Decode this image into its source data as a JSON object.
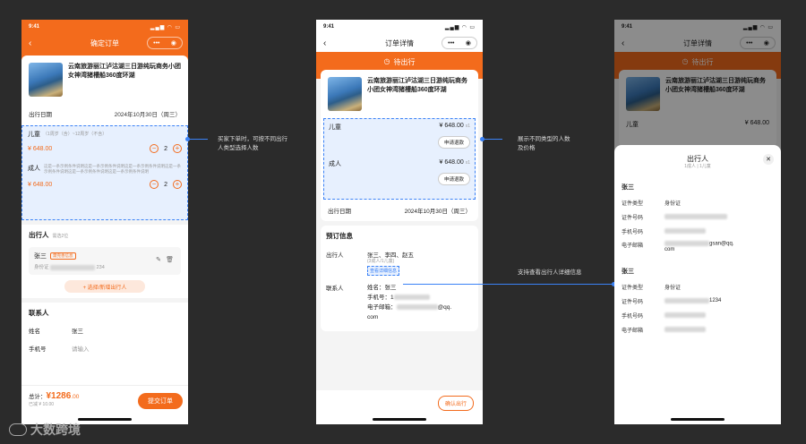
{
  "status_time": "9:41",
  "product": {
    "title": "云南旅游丽江泸沽湖三日游纯玩商务小团女神湾猪槽船360度环湖"
  },
  "phone1": {
    "nav_title": "确定订单",
    "date_label": "出行日期",
    "date_value": "2024年10月30日（周三）",
    "child_label": "儿童",
    "child_desc": "（1周岁（含）~12周岁（不含）",
    "child_price": "¥ 648.00",
    "child_qty": "2",
    "adult_label": "成人",
    "adult_desc": "这是一条示例条件说明这是一条示例条件说明这是一条示例条件说明这是一条示例条件说明这是一条示例条件说明这是一条示例条件说明",
    "adult_price": "¥ 648.00",
    "adult_qty": "2",
    "traveler_title": "出行人",
    "traveler_hint": "需选2位",
    "traveler_name": "张三",
    "traveler_tag": "需完善信息",
    "traveler_id_label": "身份证",
    "traveler_id_tail": "234",
    "add_traveler": "+ 选择/新增出行人",
    "contact_title": "联系人",
    "name_label": "姓名",
    "name_value": "张三",
    "phone_label": "手机号",
    "phone_placeholder": "请输入",
    "total_label": "总计：",
    "total_value": "¥1286",
    "total_cents": ".00",
    "discount": "已减 ¥ 10.00",
    "submit": "提交订单"
  },
  "phone2": {
    "nav_title": "订单详情",
    "status": "待出行",
    "child_label": "儿童",
    "child_price": "¥ 648.00",
    "child_qty": "x1",
    "refund": "申请退款",
    "adult_label": "成人",
    "adult_price": "¥ 648.00",
    "adult_qty": "x1",
    "date_label": "出行日期",
    "date_value": "2024年10月30日（周三）",
    "booking_title": "预订信息",
    "traveler_label": "出行人",
    "traveler_names": "张三、李四、赵五",
    "traveler_sub": "(3成人/1儿童)",
    "view_detail": "查看详细信息",
    "contact_label": "联系人",
    "contact_name": "姓名：张三",
    "contact_phone": "手机号：1",
    "contact_email": "电子邮箱：",
    "email_suffix": "@qq.",
    "email_com": "com",
    "confirm": "确认出行"
  },
  "phone3": {
    "nav_title": "订单详情",
    "status": "待出行",
    "child_label": "儿童",
    "child_price": "¥ 648.00",
    "sheet_title": "出行人",
    "sheet_sub": "1成人 | 1儿童",
    "p1_name": "张三",
    "p2_name": "张三",
    "cert_type_label": "证件类型",
    "cert_type_value": "身份证",
    "cert_no_label": "证件号码",
    "cert_no_tail": "1234",
    "phone_label": "手机号码",
    "email_label": "电子邮箱",
    "email_tail": "gsan@qq.",
    "email_com": "com"
  },
  "annotations": {
    "a1_line1": "买家下单时，可按不同出行",
    "a1_line2": "人类型选择人数",
    "a2_line1": "展示不同类型的人数",
    "a2_line2": "及价格",
    "a3": "支持查看出行人详细信息"
  },
  "watermark": "大数跨境",
  "colors": {
    "accent": "#f36b1c",
    "highlight": "#3b82f6"
  }
}
